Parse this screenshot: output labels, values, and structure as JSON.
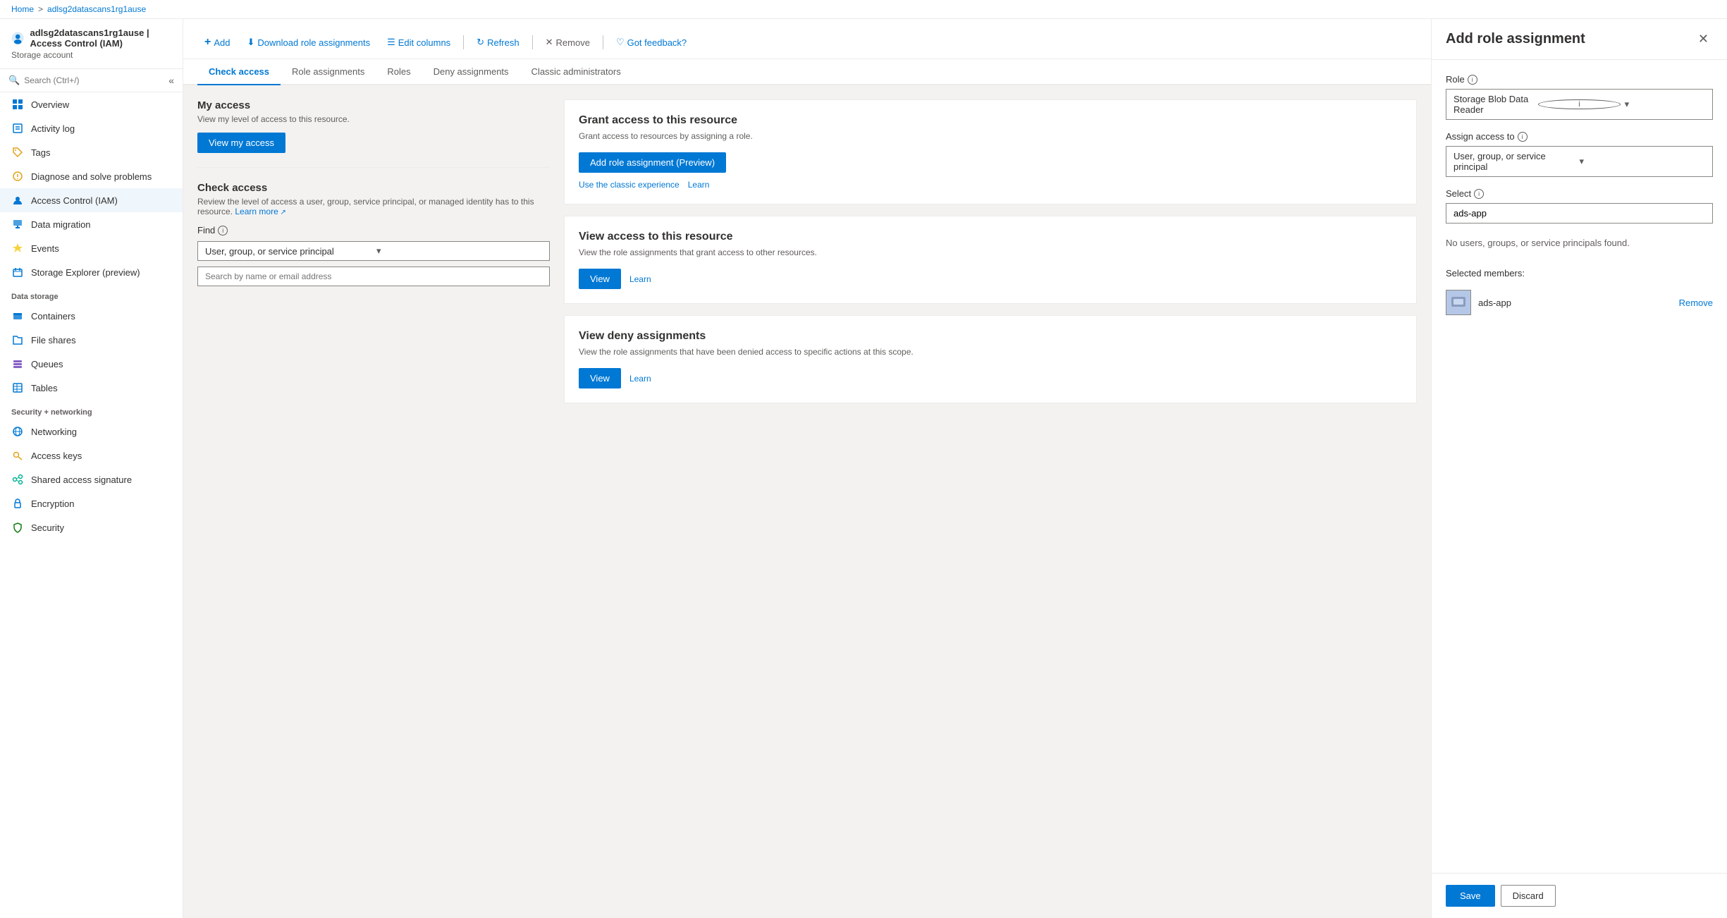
{
  "breadcrumb": {
    "home": "Home",
    "separator": ">",
    "resource": "adlsg2datascans1rg1ause"
  },
  "header": {
    "title": "adlsg2datascans1rg1ause | Access Control (IAM)",
    "subtitle": "Storage account",
    "more_icon": "···"
  },
  "sidebar": {
    "search_placeholder": "Search (Ctrl+/)",
    "collapse_label": "«",
    "items": [
      {
        "id": "overview",
        "label": "Overview",
        "icon": "⬜",
        "color": "#0078d4"
      },
      {
        "id": "activity-log",
        "label": "Activity log",
        "icon": "📋",
        "color": "#0078d4"
      },
      {
        "id": "tags",
        "label": "Tags",
        "icon": "🏷",
        "color": "#e3a21a"
      },
      {
        "id": "diagnose",
        "label": "Diagnose and solve problems",
        "icon": "🔧",
        "color": "#e3a21a"
      },
      {
        "id": "iam",
        "label": "Access Control (IAM)",
        "icon": "👤",
        "color": "#0078d4",
        "active": true
      }
    ],
    "data_migration": {
      "label": "Data migration",
      "icon": "📦",
      "color": "#0078d4"
    },
    "events": {
      "label": "Events",
      "icon": "⚡",
      "color": "#f7d23e"
    },
    "storage_explorer": {
      "label": "Storage Explorer (preview)",
      "icon": "🗂",
      "color": "#0078d4"
    },
    "data_storage_label": "Data storage",
    "data_storage_items": [
      {
        "id": "containers",
        "label": "Containers",
        "icon": "📦",
        "color": "#0078d4"
      },
      {
        "id": "file-shares",
        "label": "File shares",
        "icon": "📁",
        "color": "#0078d4"
      },
      {
        "id": "queues",
        "label": "Queues",
        "icon": "🟣",
        "color": "#8661c5"
      },
      {
        "id": "tables",
        "label": "Tables",
        "icon": "⬜",
        "color": "#0078d4"
      }
    ],
    "security_label": "Security + networking",
    "security_items": [
      {
        "id": "networking",
        "label": "Networking",
        "icon": "🌐",
        "color": "#0078d4"
      },
      {
        "id": "access-keys",
        "label": "Access keys",
        "icon": "🔑",
        "color": "#e3a21a"
      },
      {
        "id": "shared-access",
        "label": "Shared access signature",
        "icon": "🔗",
        "color": "#00b294"
      },
      {
        "id": "encryption",
        "label": "Encryption",
        "icon": "🔒",
        "color": "#0078d4"
      },
      {
        "id": "security",
        "label": "Security",
        "icon": "🛡",
        "color": "#107c10"
      }
    ]
  },
  "toolbar": {
    "add_label": "Add",
    "download_label": "Download role assignments",
    "edit_columns_label": "Edit columns",
    "refresh_label": "Refresh",
    "remove_label": "Remove",
    "feedback_label": "Got feedback?"
  },
  "tabs": [
    {
      "id": "check-access",
      "label": "Check access",
      "active": true
    },
    {
      "id": "role-assignments",
      "label": "Role assignments"
    },
    {
      "id": "roles",
      "label": "Roles"
    },
    {
      "id": "deny-assignments",
      "label": "Deny assignments"
    },
    {
      "id": "classic-administrators",
      "label": "Classic administrators"
    }
  ],
  "check_access": {
    "my_access": {
      "title": "My access",
      "description": "View my level of access to this resource.",
      "button_label": "View my access"
    },
    "check_access": {
      "title": "Check access",
      "description": "Review the level of access a user, group, service principal, or managed identity has to this resource.",
      "learn_more": "Learn more",
      "find_label": "Find",
      "dropdown_value": "User, group, or service principal",
      "search_placeholder": "Search by name or email address"
    }
  },
  "right_cards": {
    "grant": {
      "title": "Grant access to this resource",
      "description": "Grant access to resources by assigning a role.",
      "add_button": "Add role assignment (Preview)",
      "classic_link": "Use the classic experience",
      "learn_link": "Learn"
    },
    "view_access": {
      "title": "View access to this resource",
      "description": "View the role assignments that grant access to other resources.",
      "view_button": "View",
      "learn_link": "Learn"
    },
    "view_deny": {
      "title": "View deny assignments",
      "description": "View the role assignments that have been denied access to specific actions at this scope.",
      "view_button": "View",
      "learn_link": "Learn"
    }
  },
  "side_panel": {
    "title": "Add role assignment",
    "close_label": "✕",
    "role_label": "Role",
    "role_info": "ⓘ",
    "role_value": "Storage Blob Data Reader",
    "assign_label": "Assign access to",
    "assign_info": "ⓘ",
    "assign_value": "User, group, or service principal",
    "select_label": "Select",
    "select_info": "ⓘ",
    "search_value": "ads-app",
    "no_results": "No users, groups, or service principals found.",
    "selected_members_label": "Selected members:",
    "members": [
      {
        "name": "ads-app",
        "avatar_color": "#b4c7e7"
      }
    ],
    "remove_label": "Remove",
    "save_label": "Save",
    "discard_label": "Discard"
  }
}
